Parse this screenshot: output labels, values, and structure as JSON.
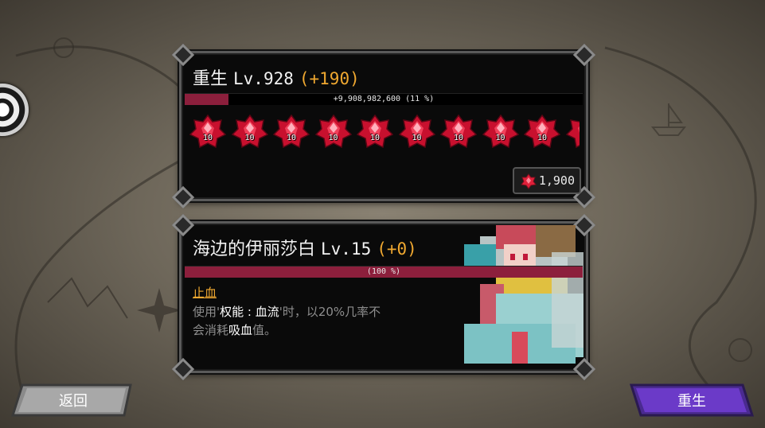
{
  "rebirth_panel": {
    "title_name": "重生",
    "title_level": "Lv.928",
    "title_bonus": "(+190)",
    "progress_text": "+9,908,982,600 (11 %)",
    "progress_fraction": 0.11,
    "gem_label": "10",
    "gem_count_visible": 9,
    "cost": "1,900"
  },
  "character_panel": {
    "name": "海边的伊丽莎白",
    "level": "Lv.15",
    "bonus": "(+0)",
    "progress_text": "(100 %)",
    "progress_fraction": 1.0,
    "skill_name": "止血",
    "skill_desc_1": "使用'",
    "skill_desc_hl1": "权能 : 血流",
    "skill_desc_2": "'时，以20%几率不会消耗",
    "skill_desc_hl2": "吸血",
    "skill_desc_3": "值。"
  },
  "buttons": {
    "back": "返回",
    "rebirth": "重生"
  },
  "colors": {
    "accent_orange": "#f0a830",
    "bar_red": "#8c1f3c",
    "button_purple": "#6b3ac8",
    "gem_red": "#e0203a"
  },
  "icons": {
    "gem": "red-crystal-icon"
  }
}
